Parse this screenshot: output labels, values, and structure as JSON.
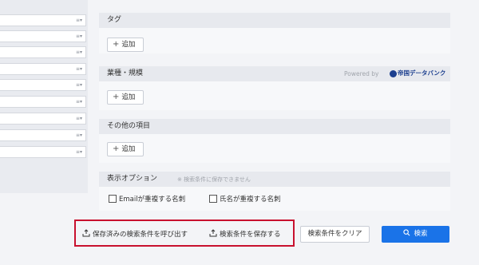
{
  "sections": {
    "tag": {
      "title": "タグ",
      "add_label": "追加"
    },
    "industry": {
      "title": "業種・規模",
      "add_label": "追加",
      "powered_by": "Powered by",
      "logo_text": "帝国データバンク"
    },
    "other": {
      "title": "その他の項目",
      "add_label": "追加"
    },
    "display_options": {
      "title": "表示オプション",
      "note": "※ 検索条件に保存できません",
      "checkboxes": [
        "Emailが重複する名刺",
        "氏名が重複する名刺"
      ]
    }
  },
  "actions": {
    "load_saved": "保存済みの検索条件を呼び出す",
    "save_conditions": "検索条件を保存する",
    "clear": "検索条件をクリア",
    "search": "検索"
  },
  "colors": {
    "accent": "#1a73e8",
    "highlight": "#c8102e"
  },
  "icons": [
    "plus-icon",
    "upload-icon",
    "search-icon",
    "list-icon"
  ]
}
